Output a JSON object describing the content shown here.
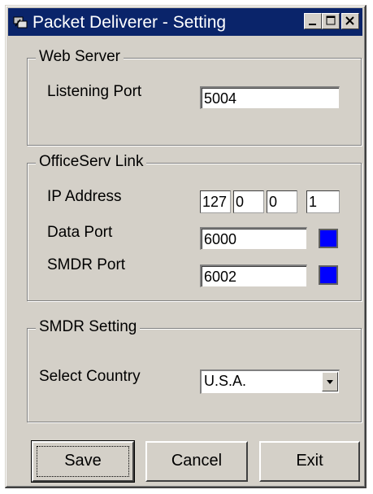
{
  "window": {
    "title": "Packet Deliverer - Setting"
  },
  "web_server": {
    "legend": "Web Server",
    "listening_port_label": "Listening Port",
    "listening_port_value": "5004"
  },
  "officeserv_link": {
    "legend": "OfficeServ Link",
    "ip_label": "IP Address",
    "ip_parts": [
      "127",
      "0",
      "0",
      "1"
    ],
    "data_port_label": "Data Port",
    "data_port_value": "6000",
    "smdr_port_label": "SMDR Port",
    "smdr_port_value": "6002",
    "status_color": "#0000ff"
  },
  "smdr_setting": {
    "legend": "SMDR Setting",
    "country_label": "Select Country",
    "country_value": "U.S.A."
  },
  "buttons": {
    "save": "Save",
    "cancel": "Cancel",
    "exit": "Exit"
  }
}
